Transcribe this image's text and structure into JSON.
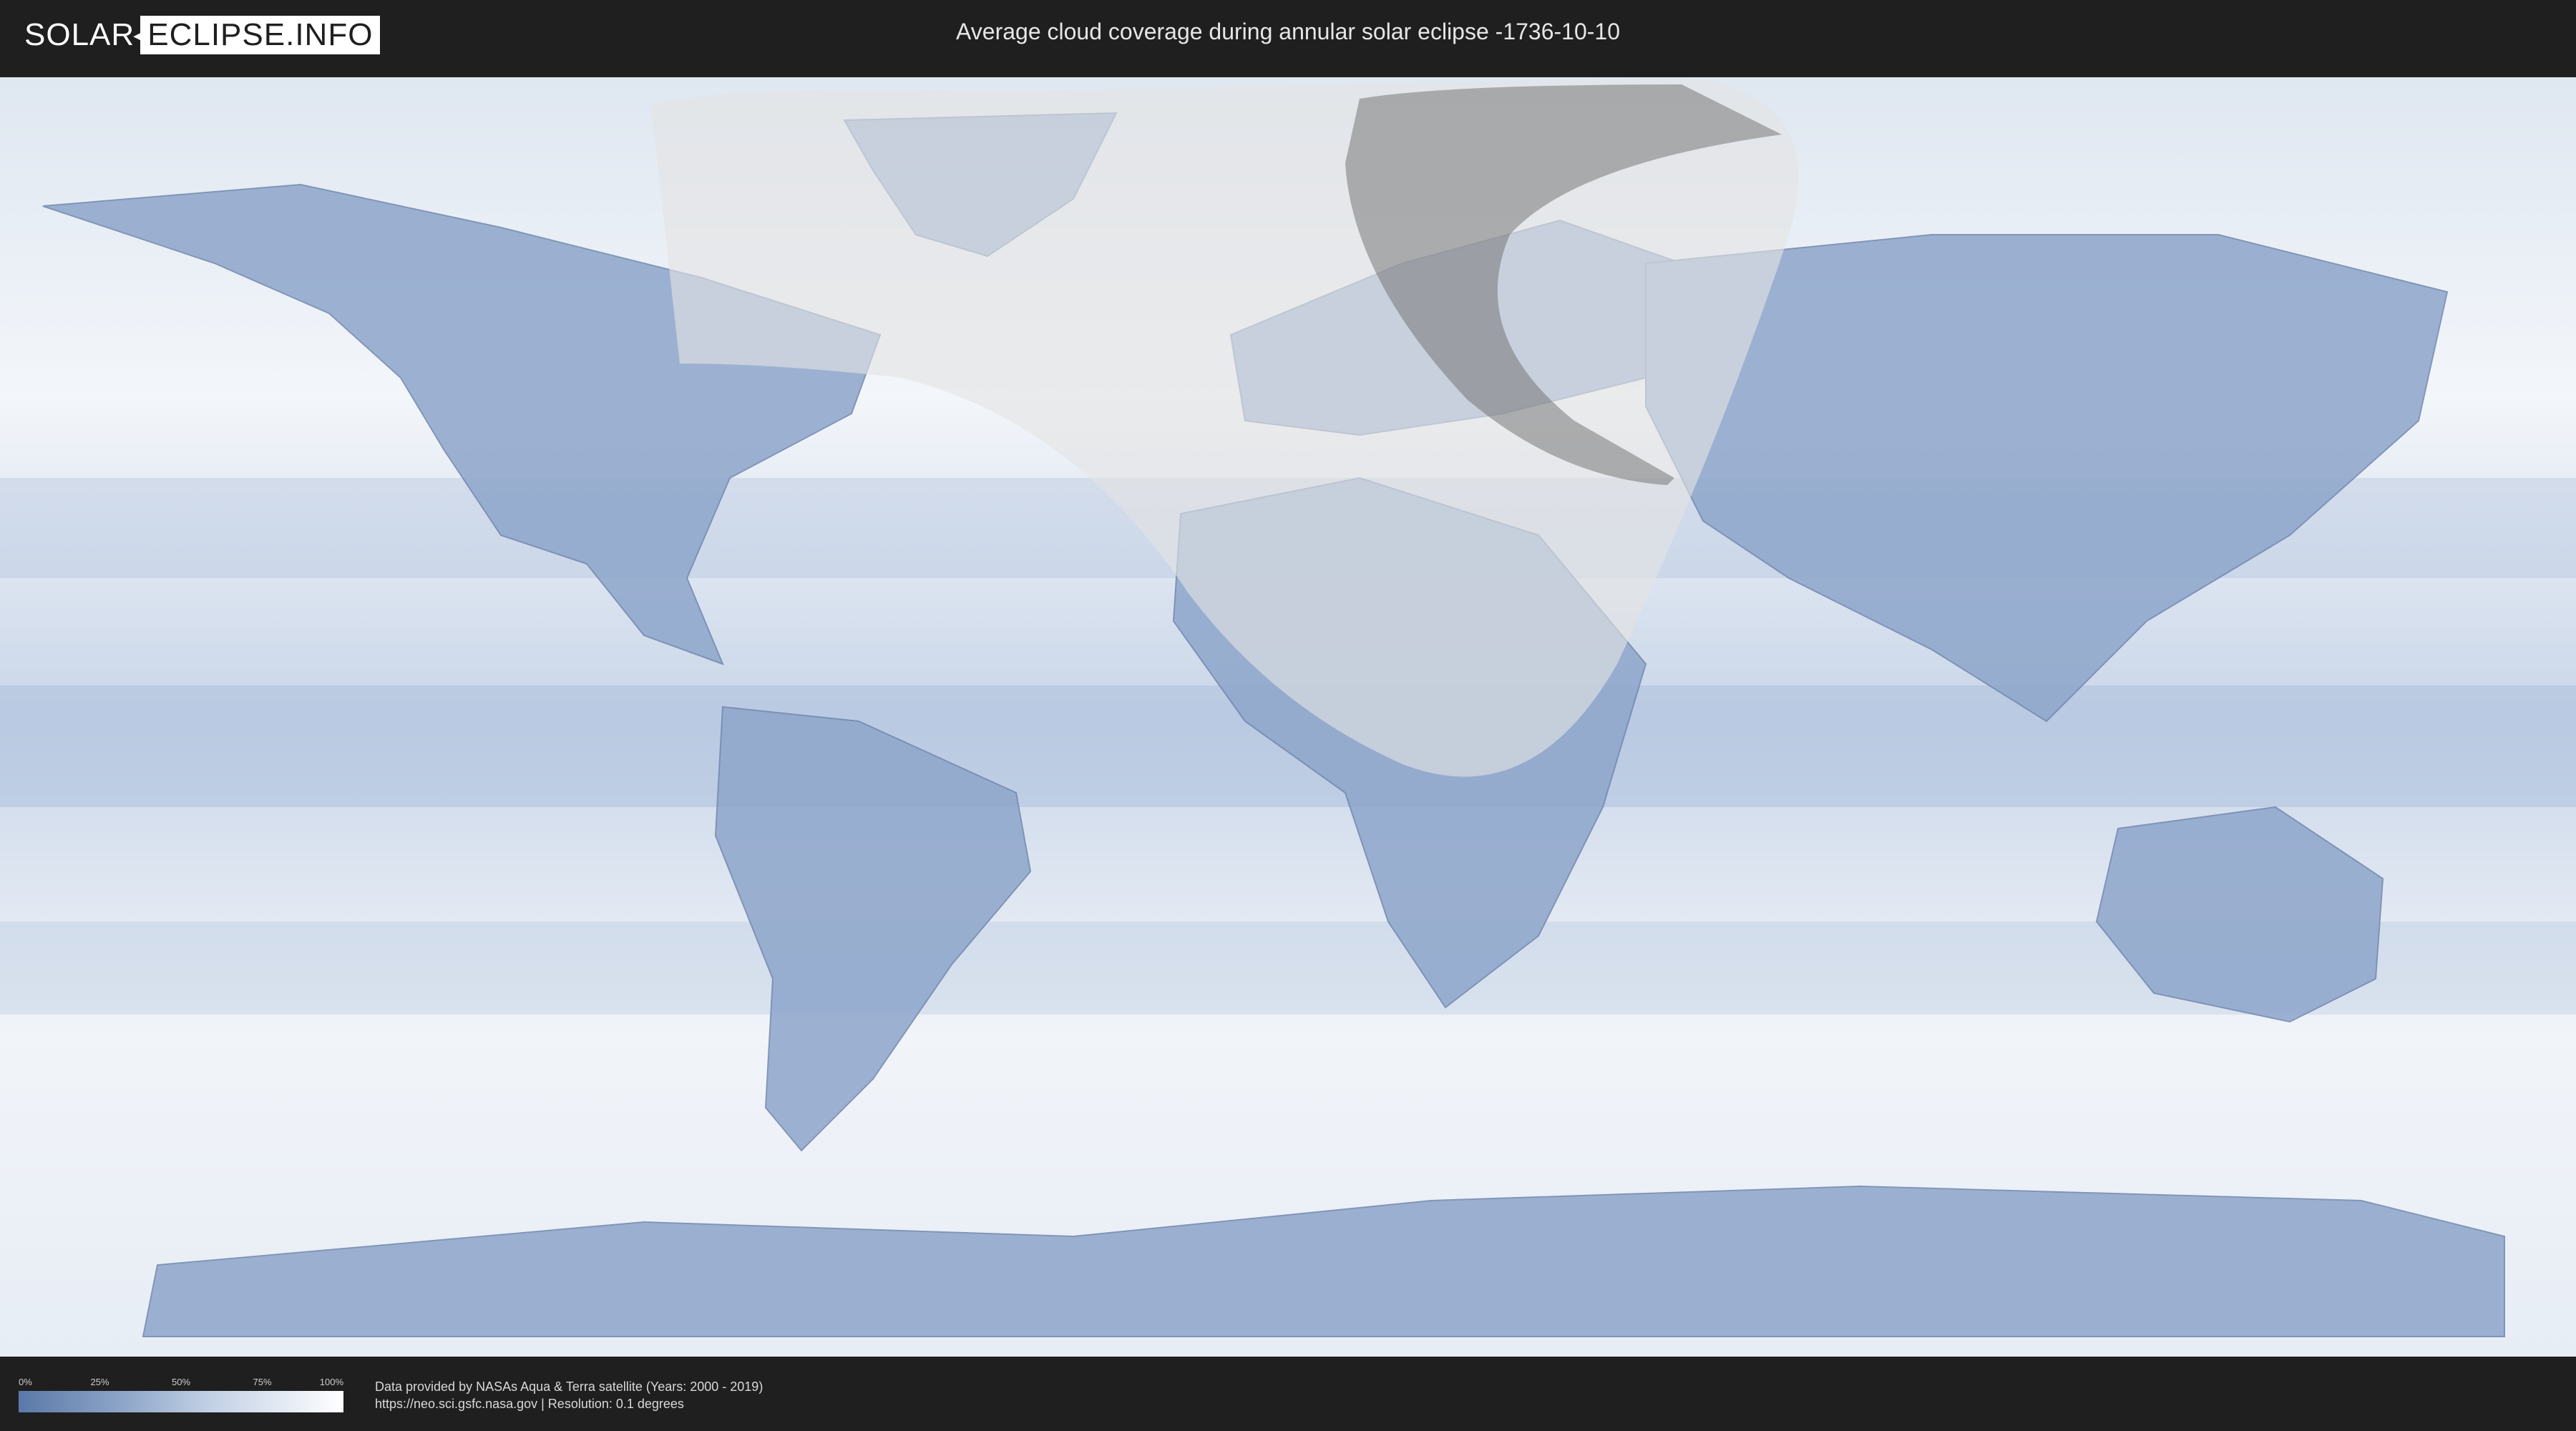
{
  "header": {
    "logo_left": "SOLAR",
    "logo_right": "ECLIPSE.INFO",
    "title": "Average cloud coverage during annular solar eclipse -1736-10-10"
  },
  "legend": {
    "ticks": [
      "0%",
      "25%",
      "50%",
      "75%",
      "100%"
    ],
    "colors": {
      "low": "#5b79a8",
      "high": "#ffffff"
    }
  },
  "credits": {
    "line1": "Data provided by NASAs Aqua & Terra satellite (Years: 2000 - 2019)",
    "line2": "https://neo.sci.gsfc.nasa.gov | Resolution: 0.1 degrees"
  },
  "map": {
    "ocean_color": "#e9eef5",
    "land_color": "#7d97c0",
    "overlay_light": "#d9d9d9",
    "overlay_dark": "#8a8a8a"
  }
}
